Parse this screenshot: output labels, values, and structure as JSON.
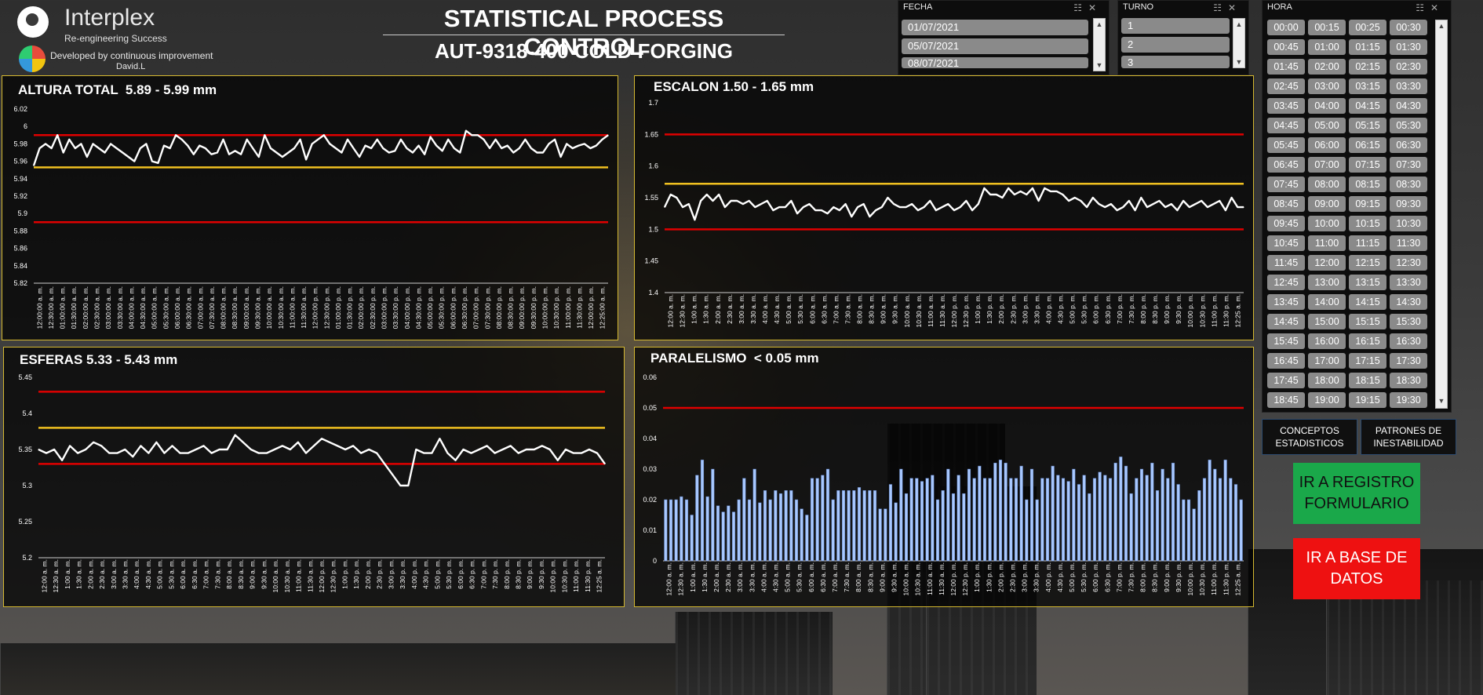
{
  "header": {
    "logo_name": "Interplex",
    "logo_tagline": "Re-engineering Success",
    "developed_by": "Developed by continuous improvement",
    "author": "David.L",
    "title_line1": "STATISTICAL PROCESS CONTROL",
    "title_line2": "AUT-9318-400 COLD FORGING"
  },
  "slicers": {
    "fecha": {
      "label": "FECHA",
      "items": [
        "01/07/2021",
        "05/07/2021",
        "08/07/2021"
      ]
    },
    "turno": {
      "label": "TURNO",
      "items": [
        "1",
        "2",
        "3"
      ]
    },
    "hora": {
      "label": "HORA",
      "items": [
        "00:00",
        "00:15",
        "00:25",
        "00:30",
        "00:45",
        "01:00",
        "01:15",
        "01:30",
        "01:45",
        "02:00",
        "02:15",
        "02:30",
        "02:45",
        "03:00",
        "03:15",
        "03:30",
        "03:45",
        "04:00",
        "04:15",
        "04:30",
        "04:45",
        "05:00",
        "05:15",
        "05:30",
        "05:45",
        "06:00",
        "06:15",
        "06:30",
        "06:45",
        "07:00",
        "07:15",
        "07:30",
        "07:45",
        "08:00",
        "08:15",
        "08:30",
        "08:45",
        "09:00",
        "09:15",
        "09:30",
        "09:45",
        "10:00",
        "10:15",
        "10:30",
        "10:45",
        "11:00",
        "11:15",
        "11:30",
        "11:45",
        "12:00",
        "12:15",
        "12:30",
        "12:45",
        "13:00",
        "13:15",
        "13:30",
        "13:45",
        "14:00",
        "14:15",
        "14:30",
        "14:45",
        "15:00",
        "15:15",
        "15:30",
        "15:45",
        "16:00",
        "16:15",
        "16:30",
        "16:45",
        "17:00",
        "17:15",
        "17:30",
        "17:45",
        "18:00",
        "18:15",
        "18:30",
        "18:45",
        "19:00",
        "19:15",
        "19:30"
      ]
    }
  },
  "buttons": {
    "conceptos": "CONCEPTOS ESTADISTICOS",
    "patrones": "PATRONES DE INESTABILIDAD",
    "registro": "IR A REGISTRO FORMULARIO",
    "base_datos": "IR A BASE DE DATOS"
  },
  "colors": {
    "limit_red": "#e00000",
    "center_yellow": "#f0c020",
    "series_white": "#ffffff",
    "bar_blue": "#a8c8ff",
    "frame_gold": "#d4b830",
    "btn_green": "#1aa84a",
    "btn_red": "#ee1111"
  },
  "chart_data": [
    {
      "id": "altura",
      "type": "line",
      "title": "ALTURA TOTAL  5.89 - 5.99 mm",
      "ylim": [
        5.82,
        6.02
      ],
      "yticks": [
        5.82,
        5.84,
        5.86,
        5.88,
        5.9,
        5.92,
        5.94,
        5.96,
        5.98,
        6,
        6.02
      ],
      "x": [
        "12:00:00 a. m.",
        "12:30:00 a. m.",
        "01:00:00 a. m.",
        "01:30:00 a. m.",
        "02:00:00 a. m.",
        "02:30:00 a. m.",
        "03:00:00 a. m.",
        "03:30:00 a. m.",
        "04:00:00 a. m.",
        "04:30:00 a. m.",
        "05:00:00 a. m.",
        "05:30:00 a. m.",
        "06:00:00 a. m.",
        "06:30:00 a. m.",
        "07:00:00 a. m.",
        "07:30:00 a. m.",
        "08:00:00 a. m.",
        "08:30:00 a. m.",
        "09:00:00 a. m.",
        "09:30:00 a. m.",
        "10:00:00 a. m.",
        "10:30:00 a. m.",
        "11:00:00 a. m.",
        "11:30:00 a. m.",
        "12:00:00 p. m.",
        "12:30:00 p. m.",
        "01:00:00 p. m.",
        "01:30:00 p. m.",
        "02:00:00 p. m.",
        "02:30:00 p. m.",
        "03:00:00 p. m.",
        "03:30:00 p. m.",
        "04:00:00 p. m.",
        "04:30:00 p. m.",
        "05:00:00 p. m.",
        "05:30:00 p. m.",
        "06:00:00 p. m.",
        "06:30:00 p. m.",
        "07:00:00 p. m.",
        "07:30:00 p. m.",
        "08:00:00 p. m.",
        "08:30:00 p. m.",
        "09:00:00 p. m.",
        "09:30:00 p. m.",
        "10:00:00 p. m.",
        "10:30:00 p. m.",
        "11:00:00 p. m.",
        "11:30:00 p. m.",
        "12:00:00 p. m.",
        "12:25:00 a. m."
      ],
      "values": [
        5.955,
        5.975,
        5.98,
        5.975,
        5.99,
        5.97,
        5.985,
        5.975,
        5.98,
        5.965,
        5.98,
        5.975,
        5.97,
        5.98,
        5.975,
        5.97,
        5.965,
        5.96,
        5.975,
        5.98,
        5.96,
        5.958,
        5.978,
        5.975,
        5.99,
        5.985,
        5.978,
        5.968,
        5.978,
        5.975,
        5.968,
        5.97,
        5.985,
        5.968,
        5.972,
        5.968,
        5.985,
        5.975,
        5.965,
        5.99,
        5.975,
        5.97,
        5.965,
        5.97,
        5.975,
        5.985,
        5.962,
        5.98,
        5.985,
        5.99,
        5.98,
        5.975,
        5.97,
        5.985,
        5.975,
        5.965,
        5.978,
        5.975,
        5.985,
        5.975,
        5.97,
        5.972,
        5.985,
        5.975,
        5.97,
        5.978,
        5.968,
        5.988,
        5.978,
        5.972,
        5.985,
        5.975,
        5.97,
        5.995,
        5.99,
        5.99,
        5.985,
        5.975,
        5.985,
        5.975,
        5.978,
        5.97,
        5.975,
        5.985,
        5.975,
        5.97,
        5.97,
        5.98,
        5.985,
        5.965,
        5.98,
        5.975,
        5.978,
        5.98,
        5.975,
        5.978,
        5.985,
        5.99
      ],
      "limits": {
        "lcl": 5.89,
        "ucl": 5.99,
        "center": 5.953
      }
    },
    {
      "id": "escalon",
      "type": "line",
      "title": "ESCALON 1.50 - 1.65 mm",
      "ylim": [
        1.4,
        1.7
      ],
      "yticks": [
        1.4,
        1.45,
        1.5,
        1.55,
        1.6,
        1.65,
        1.7
      ],
      "x": [
        "12:00 a. m.",
        "12:30 a. m.",
        "1:00 a. m.",
        "1:30 a. m.",
        "2:00 a. m.",
        "2:30 a. m.",
        "3:00 a. m.",
        "3:30 a. m.",
        "4:00 a. m.",
        "4:30 a. m.",
        "5:00 a. m.",
        "5:30 a. m.",
        "6:00 a. m.",
        "6:30 a. m.",
        "7:00 a. m.",
        "7:30 a. m.",
        "8:00 a. m.",
        "8:30 a. m.",
        "9:00 a. m.",
        "9:30 a. m.",
        "10:00 a. m.",
        "10:30 a. m.",
        "11:00 a. m.",
        "11:30 a. m.",
        "12:00 p. m.",
        "12:30 p. m.",
        "1:00 p. m.",
        "1:30 p. m.",
        "2:00 p. m.",
        "2:30 p. m.",
        "3:00 p. m.",
        "3:30 p. m.",
        "4:00 p. m.",
        "4:30 p. m.",
        "5:00 p. m.",
        "5:30 p. m.",
        "6:00 p. m.",
        "6:30 p. m.",
        "7:00 p. m.",
        "7:30 p. m.",
        "8:00 p. m.",
        "8:30 p. m.",
        "9:00 p. m.",
        "9:30 p. m.",
        "10:00 p. m.",
        "10:30 p. m.",
        "11:00 p. m.",
        "11:30 p. m.",
        "12:25 a. m."
      ],
      "values": [
        1.535,
        1.555,
        1.55,
        1.535,
        1.54,
        1.515,
        1.545,
        1.555,
        1.545,
        1.555,
        1.535,
        1.545,
        1.545,
        1.54,
        1.545,
        1.535,
        1.54,
        1.545,
        1.53,
        1.535,
        1.535,
        1.545,
        1.525,
        1.535,
        1.54,
        1.53,
        1.53,
        1.525,
        1.535,
        1.53,
        1.54,
        1.52,
        1.535,
        1.54,
        1.52,
        1.53,
        1.535,
        1.55,
        1.54,
        1.535,
        1.535,
        1.54,
        1.53,
        1.535,
        1.545,
        1.53,
        1.535,
        1.54,
        1.53,
        1.535,
        1.545,
        1.53,
        1.54,
        1.565,
        1.555,
        1.555,
        1.55,
        1.565,
        1.555,
        1.56,
        1.555,
        1.565,
        1.545,
        1.565,
        1.56,
        1.56,
        1.555,
        1.545,
        1.55,
        1.545,
        1.535,
        1.55,
        1.54,
        1.535,
        1.54,
        1.53,
        1.535,
        1.545,
        1.53,
        1.55,
        1.535,
        1.54,
        1.545,
        1.535,
        1.54,
        1.53,
        1.545,
        1.535,
        1.54,
        1.545,
        1.535,
        1.54,
        1.545,
        1.53,
        1.55,
        1.535,
        1.535
      ],
      "limits": {
        "lcl": 1.5,
        "ucl": 1.65,
        "center": 1.572
      }
    },
    {
      "id": "esferas",
      "type": "line",
      "title": "ESFERAS 5.33 - 5.43 mm",
      "ylim": [
        5.2,
        5.45
      ],
      "yticks": [
        5.2,
        5.25,
        5.3,
        5.35,
        5.4,
        5.45
      ],
      "x": [
        "12:00 a. m.",
        "12:30 a. m.",
        "1:00 a. m.",
        "1:30 a. m.",
        "2:00 a. m.",
        "2:30 a. m.",
        "3:00 a. m.",
        "3:30 a. m.",
        "4:00 a. m.",
        "4:30 a. m.",
        "5:00 a. m.",
        "5:30 a. m.",
        "6:00 a. m.",
        "6:30 a. m.",
        "7:00 a. m.",
        "7:30 a. m.",
        "8:00 a. m.",
        "8:30 a. m.",
        "9:00 a. m.",
        "9:30 a. m.",
        "10:00 a. m.",
        "10:30 a. m.",
        "11:00 a. m.",
        "11:30 a. m.",
        "12:00 p. m.",
        "12:30 p. m.",
        "1:00 p. m.",
        "1:30 p. m.",
        "2:00 p. m.",
        "2:30 p. m.",
        "3:00 p. m.",
        "3:30 p. m.",
        "4:00 p. m.",
        "4:30 p. m.",
        "5:00 p. m.",
        "5:30 p. m.",
        "6:00 p. m.",
        "6:30 p. m.",
        "7:00 p. m.",
        "7:30 p. m.",
        "8:00 p. m.",
        "8:30 p. m.",
        "9:00 p. m.",
        "9:30 p. m.",
        "10:00 p. m.",
        "10:30 p. m.",
        "11:00 p. m.",
        "11:30 p. m.",
        "12:25 a. m."
      ],
      "values": [
        5.35,
        5.345,
        5.35,
        5.335,
        5.355,
        5.345,
        5.35,
        5.36,
        5.355,
        5.345,
        5.345,
        5.35,
        5.34,
        5.355,
        5.345,
        5.36,
        5.345,
        5.355,
        5.345,
        5.345,
        5.35,
        5.355,
        5.345,
        5.35,
        5.35,
        5.37,
        5.36,
        5.35,
        5.345,
        5.345,
        5.35,
        5.355,
        5.35,
        5.36,
        5.345,
        5.355,
        5.365,
        5.36,
        5.355,
        5.35,
        5.355,
        5.345,
        5.35,
        5.345,
        5.33,
        5.315,
        5.3,
        5.3,
        5.35,
        5.345,
        5.345,
        5.365,
        5.345,
        5.335,
        5.35,
        5.345,
        5.35,
        5.355,
        5.345,
        5.35,
        5.355,
        5.345,
        5.35,
        5.35,
        5.355,
        5.35,
        5.335,
        5.35,
        5.345,
        5.345,
        5.35,
        5.345,
        5.33
      ],
      "limits": {
        "lcl": 5.33,
        "ucl": 5.43,
        "center": 5.38
      }
    },
    {
      "id": "paralelismo",
      "type": "bar",
      "title": "PARALELISMO  < 0.05 mm",
      "ylim": [
        0,
        0.06
      ],
      "yticks": [
        0,
        0.01,
        0.02,
        0.03,
        0.04,
        0.05,
        0.06
      ],
      "x": [
        "12:00 a. m.",
        "12:30 a. m.",
        "1:00 a. m.",
        "1:30 a. m.",
        "2:00 a. m.",
        "2:30 a. m.",
        "3:00 a. m.",
        "3:30 a. m.",
        "4:00 a. m.",
        "4:30 a. m.",
        "5:00 a. m.",
        "5:30 a. m.",
        "6:00 a. m.",
        "6:30 a. m.",
        "7:00 a. m.",
        "7:30 a. m.",
        "8:00 a. m.",
        "8:30 a. m.",
        "9:00 a. m.",
        "9:30 a. m.",
        "10:00 a. m.",
        "10:30 a. m.",
        "11:00 a. m.",
        "11:30 a. m.",
        "12:00 p. m.",
        "12:30 p. m.",
        "1:00 p. m.",
        "1:30 p. m.",
        "2:00 p. m.",
        "2:30 p. m.",
        "3:00 p. m.",
        "3:30 p. m.",
        "4:00 p. m.",
        "4:30 p. m.",
        "5:00 p. m.",
        "5:30 p. m.",
        "6:00 p. m.",
        "6:30 p. m.",
        "7:00 p. m.",
        "7:30 p. m.",
        "8:00 p. m.",
        "8:30 p. m.",
        "9:00 p. m.",
        "9:30 p. m.",
        "10:00 p. m.",
        "10:30 p. m.",
        "11:00 p. m.",
        "11:30 p. m.",
        "12:25 a. m."
      ],
      "values": [
        0.02,
        0.02,
        0.02,
        0.021,
        0.02,
        0.015,
        0.028,
        0.033,
        0.021,
        0.03,
        0.018,
        0.016,
        0.018,
        0.016,
        0.02,
        0.027,
        0.02,
        0.03,
        0.019,
        0.023,
        0.02,
        0.023,
        0.022,
        0.023,
        0.023,
        0.02,
        0.017,
        0.015,
        0.027,
        0.027,
        0.028,
        0.03,
        0.02,
        0.023,
        0.023,
        0.023,
        0.023,
        0.024,
        0.023,
        0.023,
        0.023,
        0.017,
        0.017,
        0.025,
        0.019,
        0.03,
        0.022,
        0.027,
        0.027,
        0.026,
        0.027,
        0.028,
        0.02,
        0.023,
        0.03,
        0.022,
        0.028,
        0.022,
        0.03,
        0.027,
        0.031,
        0.027,
        0.027,
        0.032,
        0.033,
        0.032,
        0.027,
        0.027,
        0.031,
        0.02,
        0.03,
        0.02,
        0.027,
        0.027,
        0.031,
        0.028,
        0.027,
        0.026,
        0.03,
        0.025,
        0.028,
        0.022,
        0.027,
        0.029,
        0.028,
        0.027,
        0.032,
        0.034,
        0.031,
        0.022,
        0.027,
        0.03,
        0.028,
        0.032,
        0.023,
        0.03,
        0.027,
        0.032,
        0.025,
        0.02,
        0.02,
        0.017,
        0.023,
        0.027,
        0.033,
        0.03,
        0.027,
        0.033,
        0.027,
        0.025,
        0.02
      ],
      "limits": {
        "ucl": 0.05
      }
    }
  ]
}
